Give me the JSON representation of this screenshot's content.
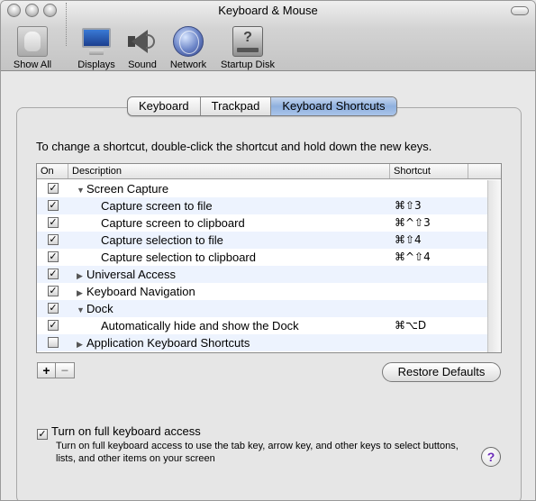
{
  "window": {
    "title": "Keyboard & Mouse"
  },
  "toolbar": {
    "items": [
      {
        "label": "Show All",
        "icon": "apple-icon"
      },
      {
        "label": "Displays",
        "icon": "display-icon"
      },
      {
        "label": "Sound",
        "icon": "speaker-icon"
      },
      {
        "label": "Network",
        "icon": "globe-icon"
      },
      {
        "label": "Startup Disk",
        "icon": "disk-icon"
      }
    ]
  },
  "tabs": [
    {
      "label": "Keyboard",
      "selected": false
    },
    {
      "label": "Trackpad",
      "selected": false
    },
    {
      "label": "Keyboard Shortcuts",
      "selected": true
    }
  ],
  "instruction": "To change a shortcut, double-click the shortcut and hold down the new keys.",
  "table": {
    "columns": {
      "on": "On",
      "description": "Description",
      "shortcut": "Shortcut"
    },
    "rows": [
      {
        "checked": true,
        "disclosure": "▼",
        "description": "Screen Capture",
        "shortcut": "",
        "child": false
      },
      {
        "checked": true,
        "disclosure": "",
        "description": "Capture screen to file",
        "shortcut": "⌘⇧3",
        "child": true
      },
      {
        "checked": true,
        "disclosure": "",
        "description": "Capture screen to clipboard",
        "shortcut": "⌘^⇧3",
        "child": true
      },
      {
        "checked": true,
        "disclosure": "",
        "description": "Capture selection to file",
        "shortcut": "⌘⇧4",
        "child": true
      },
      {
        "checked": true,
        "disclosure": "",
        "description": "Capture selection to clipboard",
        "shortcut": "⌘^⇧4",
        "child": true
      },
      {
        "checked": true,
        "disclosure": "▶",
        "description": "Universal Access",
        "shortcut": "",
        "child": false
      },
      {
        "checked": true,
        "disclosure": "▶",
        "description": "Keyboard Navigation",
        "shortcut": "",
        "child": false
      },
      {
        "checked": true,
        "disclosure": "▼",
        "description": "Dock",
        "shortcut": "",
        "child": false
      },
      {
        "checked": true,
        "disclosure": "",
        "description": "Automatically hide and show the Dock",
        "shortcut": "⌘⌥D",
        "child": true
      },
      {
        "checked": false,
        "disclosure": "▶",
        "description": "Application Keyboard Shortcuts",
        "shortcut": "",
        "child": false
      }
    ]
  },
  "buttons": {
    "add": "+",
    "remove": "−",
    "restore": "Restore Defaults",
    "help": "?"
  },
  "full_keyboard_access": {
    "checked": true,
    "label": "Turn on full keyboard access",
    "help": "Turn on full keyboard access to use the tab key, arrow key, and other keys to select buttons, lists, and other items on your screen"
  },
  "check_mark": "✓"
}
